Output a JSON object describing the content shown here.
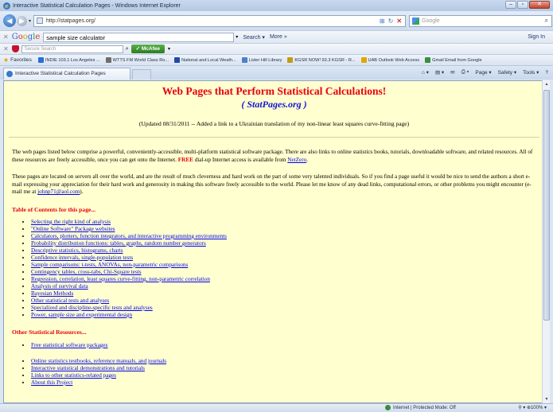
{
  "window": {
    "title": "Interactive Statistical Calculation Pages - Windows Internet Explorer",
    "ie_logo": "e",
    "controls": [
      "–",
      "▫",
      "✕"
    ]
  },
  "address_bar": {
    "back_icon": "◀",
    "forward_icon": "▶",
    "dropdown_icon": "▾",
    "url": "http://statpages.org/",
    "search_placeholder": "Google",
    "search_icon": "⌕",
    "buttons": [
      "⊞",
      "↻",
      "✕"
    ]
  },
  "google_toolbar": {
    "close": "✕",
    "logo_parts": [
      "G",
      "o",
      "o",
      "g",
      "l",
      "e"
    ],
    "query": "sample size calculator",
    "search_label": "Search ▾",
    "more_label": "More »",
    "sign_in": "Sign In",
    "dropdown_icon": "▾"
  },
  "mcafee_toolbar": {
    "close": "✕",
    "search_placeholder": "Secure Search",
    "search_icon": "⌕",
    "brand_button": "✓ McAfee",
    "dropdown_icon": "▾"
  },
  "favorites_bar": {
    "label": "Favorites",
    "star_icon": "★",
    "items": [
      "INDIE 103.1 Los Angeles ...",
      "WTTS FM World Class Ro...",
      "National and Local Weath...",
      "Lister Hill Library",
      "KGSR NOW! 93.3 KGSR - R...",
      "UAB Outlook Web Access",
      "Gmail Email from Google"
    ],
    "item_colors": [
      "#2b6ed4",
      "#6d6d6d",
      "#1f4aa8",
      "#4d7fc9",
      "#c39a1a",
      "#e0a600",
      "#3a8e3a"
    ]
  },
  "tab_bar": {
    "tab_title": "Interactive Statistical Calculation Pages",
    "commands": [
      "Page ▾",
      "Safety ▾",
      "Tools ▾",
      "?"
    ],
    "command_icons": [
      "⌂ ▾",
      "▤ ▾",
      "✉",
      "⎙ ▾"
    ]
  },
  "page": {
    "heading": "Web Pages that Perform Statistical Calculations!",
    "subheading": "( StatPages.org )",
    "updated": "(Updated 08/31/2011 -- Added a link to a Ukrainian translation of my non-linear least squares curve-fitting page)",
    "para1_text": "The web pages listed below comprise a powerful, conveniently-accessible, multi-platform statistical software package. There are also links to online statistics books, tutorials, downloadable software, and related resources. All of these resources are freely accessible, once you can get onto the Internet.",
    "para1_free": "FREE",
    "para1_tail": "dial-up Internet access is available from",
    "para1_link": "NetZero",
    "para2_text": "These pages are located on servers all over the world, and are the result of much cleverness and hard work on the part of some very talented individuals. So if you find a page useful it would be nice to send the authors a short e-mail expressing your appreciation for their hard work and generosity in making this software freely accessible to the world. Please let me know of any dead links, computational errors, or other problems you might encounter (e-mail me at",
    "para2_email": "johnp71@aol.com",
    "para2_close": ").",
    "toc_heading": "Table of Contents for this page...",
    "toc_items": [
      "Selecting the right kind of analysis",
      "\"Online Software\" Package websites",
      "Calculators, plotters, function integrators, and interactive programming environments",
      "Probability distribution functions: tables, graphs, random number generators",
      "Descriptive statistics, histograms, charts",
      "Confidence intervals, single-population tests",
      "Sample comparisons: t-tests, ANOVAs, non-parametric comparisons",
      "Contingency tables, cross-tabs, Chi-Square tests",
      "Regression, correlation, least squares curve-fitting, non-parametric correlation",
      "Analysis of survival data",
      "Bayesian Methods",
      "Other statistical tests and analyses",
      "Specialized and discipline-specific tests and analyses",
      "Power, sample size and experimental design"
    ],
    "other_heading": "Other Statistical Resources...",
    "other_items_a": [
      "Free statistical software packages"
    ],
    "other_items_b": [
      "Online statistics testbooks, reference manuals, and journals",
      "Interactive statistical demonstrations and tutorials",
      "Links to other statistics-related pages",
      "About this Project"
    ]
  },
  "status_bar": {
    "zone": "Internet | Protected Mode: Off",
    "zoom": "⚲ ▾   ⊕100%  ▾"
  }
}
